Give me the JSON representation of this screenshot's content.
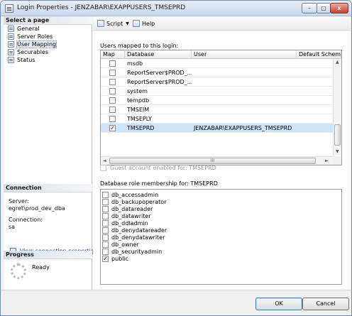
{
  "window": {
    "title": "Login Properties - JENZABAR\\EXAPPUSERS_TMSEPRD",
    "minimize": "–",
    "maximize": "□",
    "close": "x"
  },
  "select_page": {
    "heading": "Select a page",
    "items": [
      {
        "label": "General",
        "icon": "page-icon"
      },
      {
        "label": "Server Roles",
        "icon": "page-icon"
      },
      {
        "label": "User Mapping",
        "icon": "page-icon",
        "selected": true
      },
      {
        "label": "Securables",
        "icon": "page-icon"
      },
      {
        "label": "Status",
        "icon": "page-icon"
      }
    ]
  },
  "connection": {
    "heading": "Connection",
    "server_label": "Server:",
    "server_value": "egret\\prod_dev_dba",
    "connection_label": "Connection:",
    "connection_value": "sa",
    "view_link": "View connection properties"
  },
  "progress": {
    "heading": "Progress",
    "status": "Ready"
  },
  "toolbar": {
    "script": "Script",
    "help": "Help"
  },
  "mapping": {
    "label": "Users mapped to this login:",
    "columns": [
      "Map",
      "Database",
      "User",
      "Default Schem"
    ],
    "rows": [
      {
        "map": false,
        "database": "msdb",
        "user": ""
      },
      {
        "map": false,
        "database": "ReportServer$PROD_...",
        "user": ""
      },
      {
        "map": false,
        "database": "ReportServer$PROD_...",
        "user": ""
      },
      {
        "map": false,
        "database": "system",
        "user": ""
      },
      {
        "map": false,
        "database": "tempdb",
        "user": ""
      },
      {
        "map": false,
        "database": "TMSEIM",
        "user": ""
      },
      {
        "map": false,
        "database": "TMSEPLY",
        "user": ""
      },
      {
        "map": true,
        "database": "TMSEPRD",
        "user": "JENZABAR\\EXAPPUSERS_TMSEPRD",
        "selected": true
      }
    ],
    "hscroll_grip": "III"
  },
  "guest": {
    "label": "Guest account enabled for: TMSEPRD",
    "checked": false
  },
  "roles": {
    "label": "Database role membership for: TMSEPRD",
    "items": [
      {
        "name": "db_accessadmin",
        "checked": false
      },
      {
        "name": "db_backupoperator",
        "checked": false
      },
      {
        "name": "db_datareader",
        "checked": false
      },
      {
        "name": "db_datawriter",
        "checked": false
      },
      {
        "name": "db_ddladmin",
        "checked": false
      },
      {
        "name": "db_denydatareader",
        "checked": false
      },
      {
        "name": "db_denydatawriter",
        "checked": false
      },
      {
        "name": "db_owner",
        "checked": false
      },
      {
        "name": "db_securityadmin",
        "checked": false
      },
      {
        "name": "public",
        "checked": true
      }
    ]
  },
  "buttons": {
    "ok": "OK",
    "cancel": "Cancel"
  },
  "check_mark": "✓"
}
